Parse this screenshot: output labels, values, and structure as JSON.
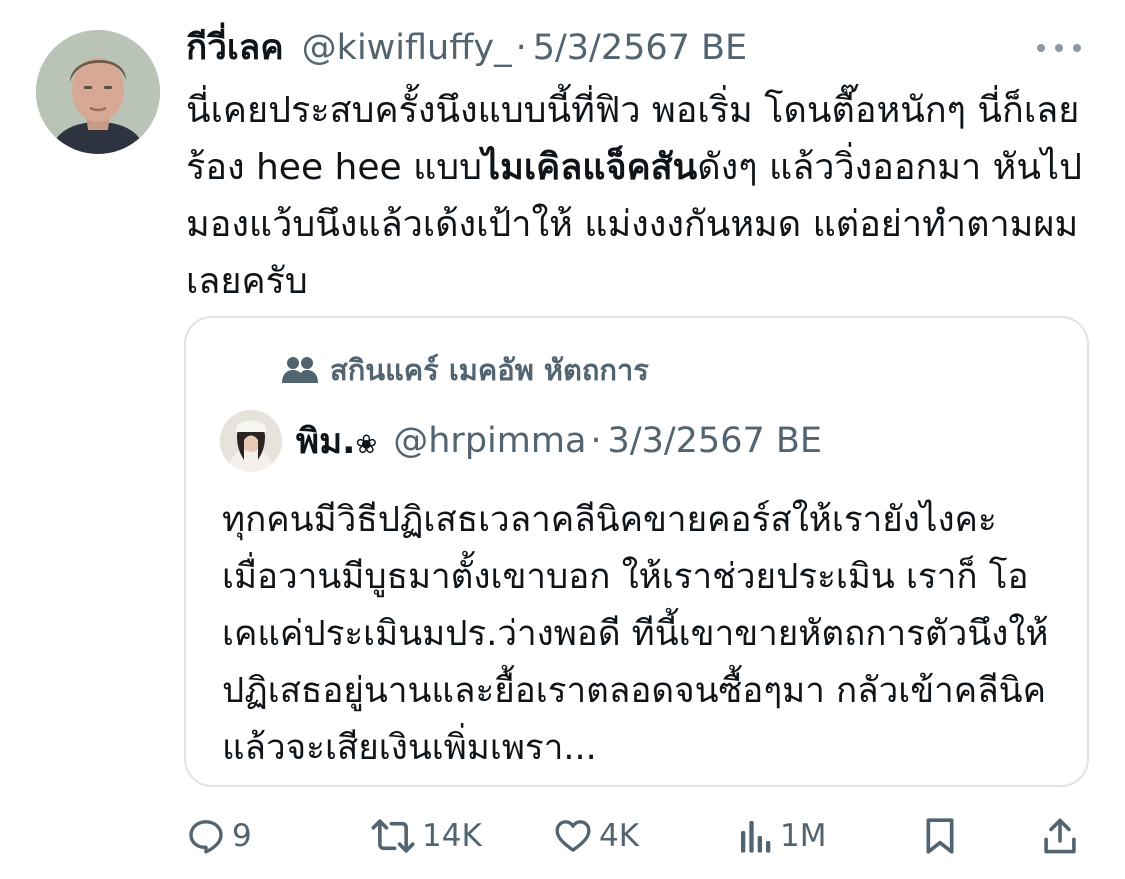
{
  "author": {
    "display_name": "กีวี่เลค",
    "handle": "@kiwifluffy_",
    "separator": "·",
    "date": "5/3/2567 BE"
  },
  "tweet": {
    "text_before_bold": "นี่เคยประสบครั้งนึงแบบนี้ที่ฟิว พอเริ่ม โดนตื๊อหนักๆ นี่ก็เลยร้อง hee hee แบบ",
    "text_bold": "ไมเคิลแจ็คสัน",
    "text_after_bold": "ดังๆ แล้ววิ่งออกมา หันไปมองแว้บนึงแล้วเด้งเป้าให้ แม่งงงกันหมด แต่อย่าทำตามผมเลยครับ"
  },
  "quote": {
    "community_label": "สกินแคร์ เมคอัพ หัตถการ",
    "author_name": "พิม.",
    "author_name_glyph": "❀",
    "author_handle": "@hrpimma",
    "separator": "·",
    "date": "3/3/2567 BE",
    "text": "ทุกคนมีวิธีปฏิเสธเวลาคลีนิคขายคอร์สให้เรายังไงคะ เมื่อวานมีบูธมาตั้งเขาบอก ให้เราช่วยประเมิน เราก็ โอเคแค่ประเมินมปร.ว่างพอดี ทีนี้เขาขายหัตถการตัวนึงให้ ปฏิเสธอยู่นานและยื้อเราตลอดจนซื้อๆมา กลัวเข้าคลีนิคแล้วจะเสียเงินเพิ่มเพรา..."
  },
  "actions": {
    "reply_count": "9",
    "retweet_count": "14K",
    "like_count": "4K",
    "views_count": "1M"
  },
  "icons": [
    "more-icon",
    "community-icon",
    "reply-icon",
    "retweet-icon",
    "like-icon",
    "views-icon",
    "bookmark-icon",
    "share-icon"
  ],
  "colors": {
    "text_primary": "#0f1419",
    "text_secondary": "#536471",
    "border": "#dde3e8"
  }
}
